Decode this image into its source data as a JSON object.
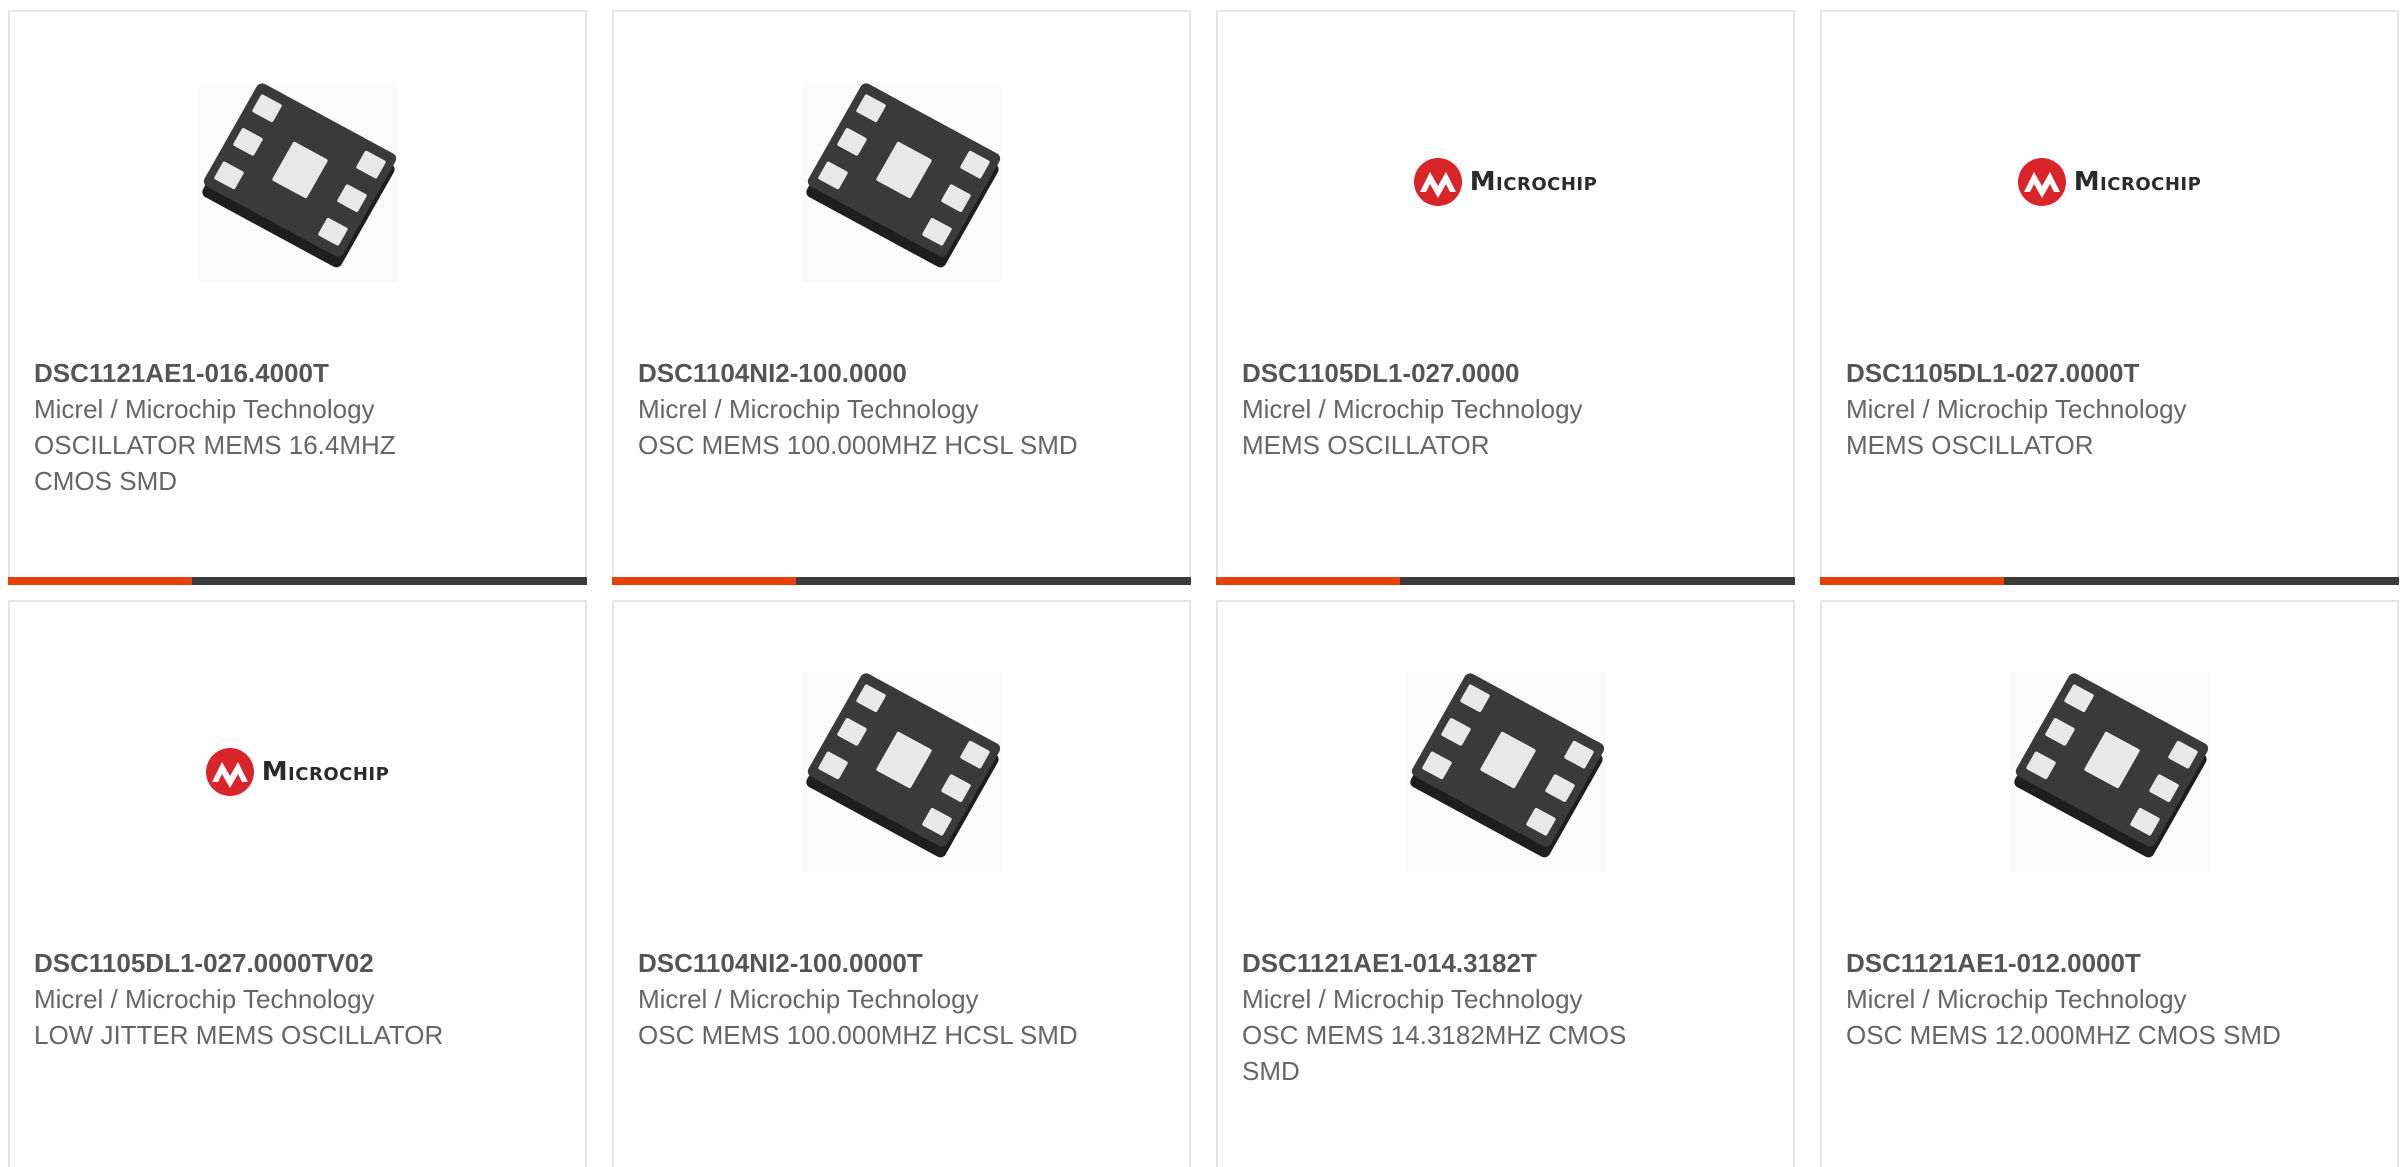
{
  "colors": {
    "accent": "#e8400c",
    "bar_dark": "#3c3c3c",
    "logo_red": "#d9242a"
  },
  "logo_text": "Microchip",
  "products": [
    {
      "part": "DSC1121AE1-016.4000T",
      "manufacturer": "Micrel / Microchip Technology",
      "description": "OSCILLATOR MEMS 16.4MHZ CMOS SMD",
      "image": "chip"
    },
    {
      "part": "DSC1104NI2-100.0000",
      "manufacturer": "Micrel / Microchip Technology",
      "description": "OSC MEMS 100.000MHZ HCSL SMD",
      "image": "chip"
    },
    {
      "part": "DSC1105DL1-027.0000",
      "manufacturer": "Micrel / Microchip Technology",
      "description": "MEMS OSCILLATOR",
      "image": "logo"
    },
    {
      "part": "DSC1105DL1-027.0000T",
      "manufacturer": "Micrel / Microchip Technology",
      "description": "MEMS OSCILLATOR",
      "image": "logo"
    },
    {
      "part": "DSC1105DL1-027.0000TV02",
      "manufacturer": "Micrel / Microchip Technology",
      "description": "LOW JITTER MEMS OSCILLATOR",
      "image": "logo"
    },
    {
      "part": "DSC1104NI2-100.0000T",
      "manufacturer": "Micrel / Microchip Technology",
      "description": "OSC MEMS 100.000MHZ HCSL SMD",
      "image": "chip"
    },
    {
      "part": "DSC1121AE1-014.3182T",
      "manufacturer": "Micrel / Microchip Technology",
      "description": "OSC MEMS 14.3182MHZ CMOS SMD",
      "image": "chip"
    },
    {
      "part": "DSC1121AE1-012.0000T",
      "manufacturer": "Micrel / Microchip Technology",
      "description": "OSC MEMS 12.000MHZ CMOS SMD",
      "image": "chip"
    }
  ]
}
